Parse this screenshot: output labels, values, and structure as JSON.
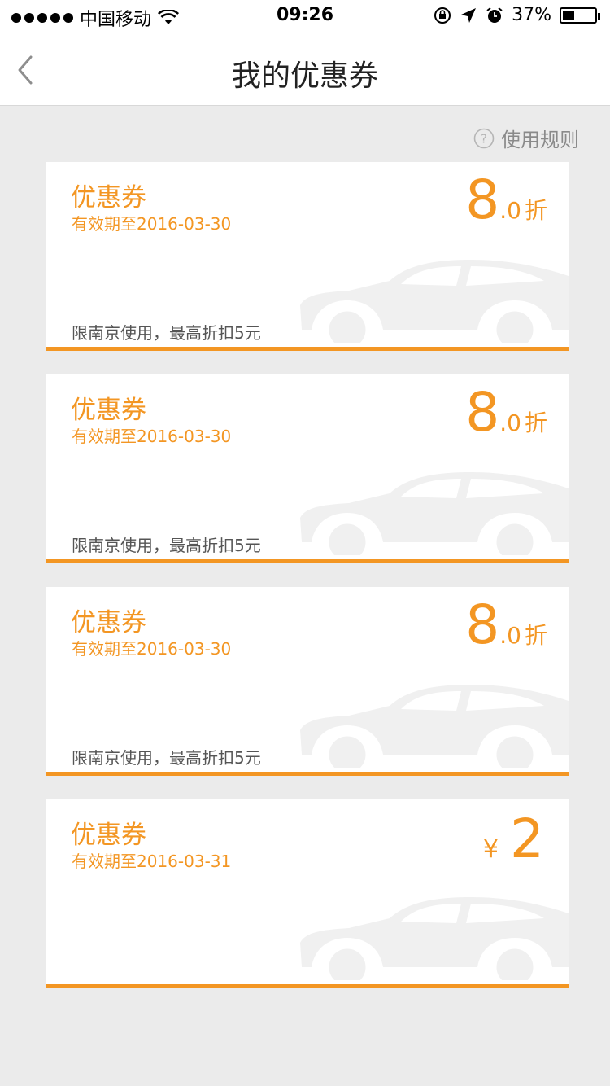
{
  "status_bar": {
    "carrier": "中国移动",
    "time": "09:26",
    "battery_percent": "37%",
    "battery_level": 0.37
  },
  "nav": {
    "title": "我的优惠券"
  },
  "rules_link": "使用规则",
  "colors": {
    "accent": "#f39623",
    "background": "#ebebeb",
    "card": "#ffffff"
  },
  "coupons": [
    {
      "name": "优惠券",
      "expiry": "有效期至2016-03-30",
      "value_int": "8",
      "value_dec": ".0",
      "value_unit": "折",
      "scope": "限南京使用，最高折扣5元"
    },
    {
      "name": "优惠券",
      "expiry": "有效期至2016-03-30",
      "value_int": "8",
      "value_dec": ".0",
      "value_unit": "折",
      "scope": "限南京使用，最高折扣5元"
    },
    {
      "name": "优惠券",
      "expiry": "有效期至2016-03-30",
      "value_int": "8",
      "value_dec": ".0",
      "value_unit": "折",
      "scope": "限南京使用，最高折扣5元"
    },
    {
      "name": "优惠券",
      "expiry": "有效期至2016-03-31",
      "currency": "¥",
      "amount": "2"
    }
  ]
}
